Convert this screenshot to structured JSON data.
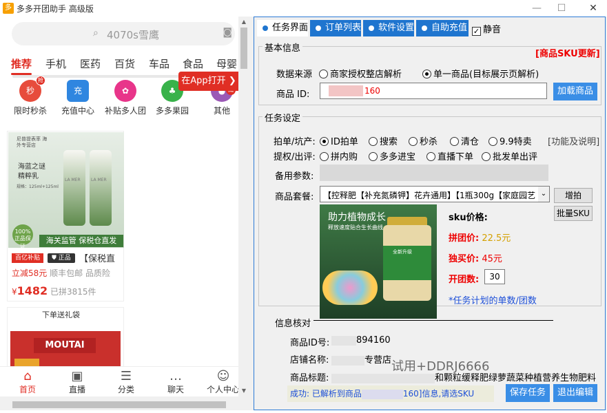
{
  "window": {
    "icon": "多",
    "title": "多多开团助手 高级版",
    "minimize": "—",
    "maximize": "☐",
    "close": "✕"
  },
  "phone": {
    "search_placeholder": "4070s雪鹰",
    "categories": [
      "推荐",
      "手机",
      "医药",
      "百货",
      "车品",
      "食品",
      "母婴"
    ],
    "icons": [
      {
        "label": "限时秒杀",
        "glyph": "秒",
        "color": "#e74c3c",
        "badge": "抢"
      },
      {
        "label": "充值中心",
        "glyph": "充",
        "color": "#2f86e0"
      },
      {
        "label": "补贴多人团",
        "glyph": "✿",
        "color": "#e8358a"
      },
      {
        "label": "多多果园",
        "glyph": "♣",
        "color": "#38b24a"
      },
      {
        "label": "其他",
        "glyph": "●",
        "color": "#9b59b6",
        "badge": "减"
      }
    ],
    "app_open": "在App打开",
    "card1": {
      "top_text": "尼普提表率 海外专营店",
      "img_title": "海蓝之谜 精粹乳",
      "img_sub": "规格：125ml+125ml",
      "bottle_text": "LA MER",
      "badge": "100% 正品保证",
      "bar_text": "海关监管 保税仓直发",
      "tag_red": "百亿补贴",
      "tag_dark": "正品",
      "title": "【保税直",
      "discount": "立减58元",
      "ship": "顺丰包邮",
      "quality": "品质险",
      "currency": "¥",
      "price": "1482",
      "sold": "已拼3815件"
    },
    "card2": {
      "banner": "下单送礼袋",
      "brand": "MOUTAI"
    },
    "nav": [
      {
        "label": "首页",
        "icon": "⌂"
      },
      {
        "label": "直播",
        "icon": "▣"
      },
      {
        "label": "分类",
        "icon": "☰"
      },
      {
        "label": "聊天",
        "icon": "…"
      },
      {
        "label": "个人中心",
        "icon": "☺"
      }
    ]
  },
  "panel": {
    "tabs": [
      "任务界面",
      "订单列表",
      "软件设置",
      "自助充值"
    ],
    "mute_label": "静音",
    "basic": {
      "title": "基本信息",
      "sku_update": "[商品SKU更新]",
      "source_label": "数据来源",
      "source_options": [
        "商家授权整店解析",
        "单一商品(目标展示页解析)"
      ],
      "product_id_label": "商品 ID:",
      "product_id_value": "160",
      "load_button": "加载商品"
    },
    "task": {
      "title": "任务设定",
      "mode_label": "拍单/坑产:",
      "mode_options": [
        "ID拍单",
        "搜索",
        "秒杀",
        "清仓",
        "9.9特卖"
      ],
      "help_link": "[功能及说明]",
      "review_label": "提权/出评:",
      "review_options": [
        "拼内购",
        "多多进宝",
        "直播下单",
        "批发单出评"
      ],
      "backup_label": "备用参数:",
      "package_label": "商品套餐:",
      "package_value": "【控释肥【补充氮磷钾】花卉通用】【1瓶300g【家庭园艺",
      "add_sku": "增拍SKU+",
      "batch_sku": "批量SKU",
      "product_img_title": "助力植物成长",
      "product_img_sub": "释放速度贴合生长曲线",
      "product_img_badge": "全新升级",
      "sku_price_label": "sku价格:",
      "group_price_label": "拼团价:",
      "group_price": "22.5元",
      "single_price_label": "独买价:",
      "single_price": "45元",
      "group_count_label": "开团数:",
      "group_count": "30",
      "note": "*任务计划的单数/团数"
    },
    "info": {
      "title": "信息核对",
      "id_label": "商品ID号:",
      "id_value": "894160",
      "store_label": "店铺名称:",
      "store_value": "专营店",
      "goods_label": "商品标题:",
      "goods_value": "和颗粒缓释肥绿萝蔬菜种植营养生物肥料",
      "status_prefix": "成功: 已解析到商品",
      "status_suffix": "160]信息,请选SKU",
      "save_button": "保存任务",
      "exit_button": "退出编辑"
    },
    "watermark": "试用+DDRJ6666"
  }
}
